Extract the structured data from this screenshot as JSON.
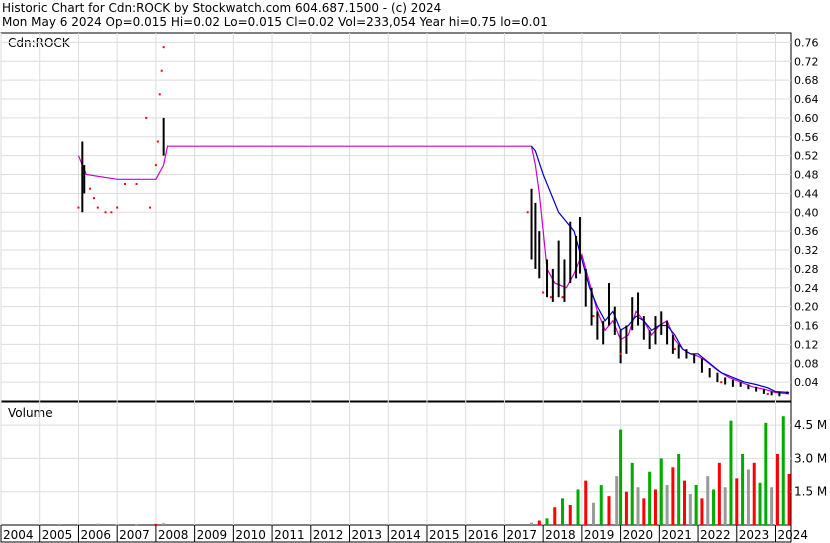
{
  "header": {
    "line1": "Historic Chart for Cdn:ROCK by Stockwatch.com 604.687.1500 - (c) 2024",
    "line2": "Mon May  6 2024   Op=0.015   Hi=0.02   Lo=0.015   Cl=0.02   Vol=233,054   Year hi=0.75   lo=0.01"
  },
  "colors": {
    "price_bar": "#000000",
    "price_mark": "#ff0000",
    "ma_short": "#0000cc",
    "ma_long": "#cc00cc",
    "volume_up": "#00aa00",
    "volume_down": "#ff0000",
    "volume_flat": "#999999",
    "grid": "#dddddd"
  },
  "chart_data": [
    {
      "type": "line",
      "title": "Cdn:ROCK",
      "x_labels": [
        "2004",
        "2005",
        "2006",
        "2007",
        "2008",
        "2009",
        "2010",
        "2011",
        "2012",
        "2013",
        "2014",
        "2015",
        "2016",
        "2017",
        "2018",
        "2019",
        "2020",
        "2021",
        "2022",
        "2023",
        "2024"
      ],
      "y_ticks": [
        0.04,
        0.08,
        0.12,
        0.16,
        0.2,
        0.24,
        0.28,
        0.32,
        0.36,
        0.4,
        0.44,
        0.48,
        0.52,
        0.56,
        0.6,
        0.64,
        0.68,
        0.72,
        0.76
      ],
      "y_tick_labels": [
        "0.04",
        "0.08",
        "0.12",
        "0.16",
        "0.20",
        "0.24",
        "0.28",
        "0.32",
        "0.36",
        "0.40",
        "0.44",
        "0.48",
        "0.52",
        "0.56",
        "0.60",
        "0.64",
        "0.68",
        "0.72",
        "0.76"
      ],
      "ylim": [
        0.0,
        0.78
      ],
      "grid": true,
      "price_bars": [
        {
          "x": 2006.1,
          "high": 0.55,
          "low": 0.4
        },
        {
          "x": 2006.15,
          "high": 0.5,
          "low": 0.44
        },
        {
          "x": 2008.2,
          "high": 0.6,
          "low": 0.52
        },
        {
          "x": 2017.7,
          "high": 0.45,
          "low": 0.3
        },
        {
          "x": 2017.8,
          "high": 0.42,
          "low": 0.28
        },
        {
          "x": 2017.9,
          "high": 0.36,
          "low": 0.26
        },
        {
          "x": 2018.1,
          "high": 0.3,
          "low": 0.22
        },
        {
          "x": 2018.25,
          "high": 0.28,
          "low": 0.21
        },
        {
          "x": 2018.4,
          "high": 0.34,
          "low": 0.22
        },
        {
          "x": 2018.55,
          "high": 0.3,
          "low": 0.21
        },
        {
          "x": 2018.7,
          "high": 0.38,
          "low": 0.25
        },
        {
          "x": 2018.85,
          "high": 0.35,
          "low": 0.26
        },
        {
          "x": 2018.95,
          "high": 0.39,
          "low": 0.27
        },
        {
          "x": 2019.1,
          "high": 0.28,
          "low": 0.2
        },
        {
          "x": 2019.25,
          "high": 0.24,
          "low": 0.16
        },
        {
          "x": 2019.4,
          "high": 0.19,
          "low": 0.13
        },
        {
          "x": 2019.55,
          "high": 0.17,
          "low": 0.12
        },
        {
          "x": 2019.7,
          "high": 0.25,
          "low": 0.16
        },
        {
          "x": 2019.85,
          "high": 0.2,
          "low": 0.14
        },
        {
          "x": 2020.0,
          "high": 0.15,
          "low": 0.08
        },
        {
          "x": 2020.15,
          "high": 0.16,
          "low": 0.1
        },
        {
          "x": 2020.3,
          "high": 0.22,
          "low": 0.15
        },
        {
          "x": 2020.45,
          "high": 0.23,
          "low": 0.16
        },
        {
          "x": 2020.6,
          "high": 0.18,
          "low": 0.13
        },
        {
          "x": 2020.75,
          "high": 0.15,
          "low": 0.11
        },
        {
          "x": 2020.9,
          "high": 0.18,
          "low": 0.12
        },
        {
          "x": 2021.05,
          "high": 0.19,
          "low": 0.14
        },
        {
          "x": 2021.2,
          "high": 0.17,
          "low": 0.12
        },
        {
          "x": 2021.35,
          "high": 0.14,
          "low": 0.1
        },
        {
          "x": 2021.5,
          "high": 0.12,
          "low": 0.09
        },
        {
          "x": 2021.7,
          "high": 0.11,
          "low": 0.09
        },
        {
          "x": 2021.9,
          "high": 0.1,
          "low": 0.08
        },
        {
          "x": 2022.1,
          "high": 0.09,
          "low": 0.06
        },
        {
          "x": 2022.3,
          "high": 0.07,
          "low": 0.05
        },
        {
          "x": 2022.5,
          "high": 0.06,
          "low": 0.04
        },
        {
          "x": 2022.7,
          "high": 0.05,
          "low": 0.035
        },
        {
          "x": 2022.9,
          "high": 0.045,
          "low": 0.03
        },
        {
          "x": 2023.1,
          "high": 0.04,
          "low": 0.03
        },
        {
          "x": 2023.3,
          "high": 0.035,
          "low": 0.025
        },
        {
          "x": 2023.5,
          "high": 0.03,
          "low": 0.02
        },
        {
          "x": 2023.7,
          "high": 0.025,
          "low": 0.015
        },
        {
          "x": 2023.9,
          "high": 0.02,
          "low": 0.012
        },
        {
          "x": 2024.1,
          "high": 0.02,
          "low": 0.01
        },
        {
          "x": 2024.3,
          "high": 0.02,
          "low": 0.015
        }
      ],
      "price_marks": [
        {
          "x": 2006.0,
          "y": 0.41
        },
        {
          "x": 2006.3,
          "y": 0.45
        },
        {
          "x": 2006.4,
          "y": 0.43
        },
        {
          "x": 2006.5,
          "y": 0.41
        },
        {
          "x": 2006.7,
          "y": 0.4
        },
        {
          "x": 2006.85,
          "y": 0.4
        },
        {
          "x": 2007.0,
          "y": 0.41
        },
        {
          "x": 2007.2,
          "y": 0.46
        },
        {
          "x": 2007.5,
          "y": 0.46
        },
        {
          "x": 2007.75,
          "y": 0.6
        },
        {
          "x": 2007.85,
          "y": 0.41
        },
        {
          "x": 2008.0,
          "y": 0.5
        },
        {
          "x": 2008.05,
          "y": 0.55
        },
        {
          "x": 2008.1,
          "y": 0.65
        },
        {
          "x": 2008.15,
          "y": 0.7
        },
        {
          "x": 2008.2,
          "y": 0.75
        },
        {
          "x": 2017.6,
          "y": 0.4
        },
        {
          "x": 2018.0,
          "y": 0.23
        },
        {
          "x": 2018.2,
          "y": 0.22
        },
        {
          "x": 2018.5,
          "y": 0.22
        },
        {
          "x": 2019.3,
          "y": 0.18
        },
        {
          "x": 2020.0,
          "y": 0.1
        },
        {
          "x": 2021.4,
          "y": 0.11
        },
        {
          "x": 2022.6,
          "y": 0.04
        },
        {
          "x": 2023.8,
          "y": 0.015
        }
      ],
      "series": [
        {
          "color_key": "ma_long",
          "x": [
            2006.0,
            2006.2,
            2007.0,
            2008.0,
            2008.2,
            2008.3,
            2010.0,
            2014.0,
            2017.7,
            2017.8,
            2017.9,
            2018.0,
            2018.1,
            2018.3,
            2018.6,
            2018.8,
            2019.0,
            2019.2,
            2019.4,
            2019.6,
            2019.8,
            2020.0,
            2020.2,
            2020.4,
            2020.6,
            2020.8,
            2021.0,
            2021.2,
            2021.4,
            2021.6,
            2021.8,
            2022.0,
            2022.2,
            2022.5,
            2022.8,
            2023.1,
            2023.4,
            2023.7,
            2024.0,
            2024.35
          ],
          "y": [
            0.52,
            0.48,
            0.47,
            0.47,
            0.5,
            0.54,
            0.54,
            0.54,
            0.54,
            0.5,
            0.44,
            0.36,
            0.28,
            0.25,
            0.24,
            0.27,
            0.31,
            0.25,
            0.19,
            0.15,
            0.17,
            0.13,
            0.14,
            0.19,
            0.17,
            0.14,
            0.16,
            0.17,
            0.13,
            0.11,
            0.1,
            0.095,
            0.085,
            0.065,
            0.05,
            0.04,
            0.03,
            0.025,
            0.018,
            0.015
          ]
        },
        {
          "color_key": "ma_short",
          "x": [
            2017.7,
            2017.8,
            2018.0,
            2018.2,
            2018.4,
            2018.6,
            2018.8,
            2019.0,
            2019.2,
            2019.4,
            2019.6,
            2019.8,
            2020.0,
            2020.2,
            2020.4,
            2020.6,
            2020.8,
            2021.0,
            2021.2,
            2021.4,
            2021.6,
            2021.8,
            2022.0,
            2022.3,
            2022.6,
            2022.9,
            2023.2,
            2023.5,
            2023.8,
            2024.0,
            2024.35
          ],
          "y": [
            0.54,
            0.53,
            0.48,
            0.44,
            0.4,
            0.38,
            0.36,
            0.3,
            0.24,
            0.2,
            0.17,
            0.19,
            0.15,
            0.16,
            0.18,
            0.17,
            0.15,
            0.16,
            0.16,
            0.14,
            0.11,
            0.1,
            0.1,
            0.08,
            0.06,
            0.05,
            0.04,
            0.035,
            0.028,
            0.02,
            0.018
          ]
        }
      ]
    },
    {
      "type": "bar",
      "title": "Volume",
      "y_ticks": [
        1500000,
        3000000,
        4500000
      ],
      "y_tick_labels": [
        "1.5 M",
        "3.0 M",
        "4.5 M"
      ],
      "ylim": [
        0,
        5000000
      ],
      "x": [
        2005.5,
        2006.0,
        2006.5,
        2007.0,
        2007.5,
        2008.0,
        2008.2,
        2017.7,
        2017.9,
        2018.1,
        2018.3,
        2018.5,
        2018.7,
        2018.9,
        2019.1,
        2019.3,
        2019.5,
        2019.7,
        2019.9,
        2020.0,
        2020.15,
        2020.3,
        2020.45,
        2020.6,
        2020.75,
        2020.9,
        2021.05,
        2021.2,
        2021.35,
        2021.5,
        2021.65,
        2021.8,
        2021.95,
        2022.1,
        2022.25,
        2022.4,
        2022.55,
        2022.7,
        2022.85,
        2023.0,
        2023.15,
        2023.3,
        2023.45,
        2023.6,
        2023.75,
        2023.9,
        2024.05,
        2024.2,
        2024.35
      ],
      "values": [
        50000,
        40000,
        60000,
        30000,
        40000,
        50000,
        80000,
        100000,
        200000,
        300000,
        800000,
        1200000,
        900000,
        1600000,
        2000000,
        1000000,
        1800000,
        1300000,
        2200000,
        4300000,
        1500000,
        2800000,
        1700000,
        1200000,
        2400000,
        1600000,
        3000000,
        1800000,
        2600000,
        3200000,
        2000000,
        1400000,
        1800000,
        1200000,
        2200000,
        1600000,
        2800000,
        1700000,
        4700000,
        2100000,
        3200000,
        2500000,
        2800000,
        1900000,
        4600000,
        1700000,
        3200000,
        4900000,
        2300000
      ],
      "colors": [
        "volume_flat",
        "volume_flat",
        "volume_flat",
        "volume_flat",
        "volume_flat",
        "volume_down",
        "volume_flat",
        "volume_flat",
        "volume_down",
        "volume_up",
        "volume_down",
        "volume_up",
        "volume_down",
        "volume_up",
        "volume_down",
        "volume_flat",
        "volume_up",
        "volume_down",
        "volume_flat",
        "volume_up",
        "volume_down",
        "volume_up",
        "volume_flat",
        "volume_down",
        "volume_up",
        "volume_down",
        "volume_up",
        "volume_flat",
        "volume_down",
        "volume_up",
        "volume_down",
        "volume_flat",
        "volume_up",
        "volume_down",
        "volume_flat",
        "volume_up",
        "volume_down",
        "volume_flat",
        "volume_up",
        "volume_down",
        "volume_up",
        "volume_flat",
        "volume_down",
        "volume_up",
        "volume_up",
        "volume_flat",
        "volume_down",
        "volume_up",
        "volume_down"
      ]
    }
  ]
}
